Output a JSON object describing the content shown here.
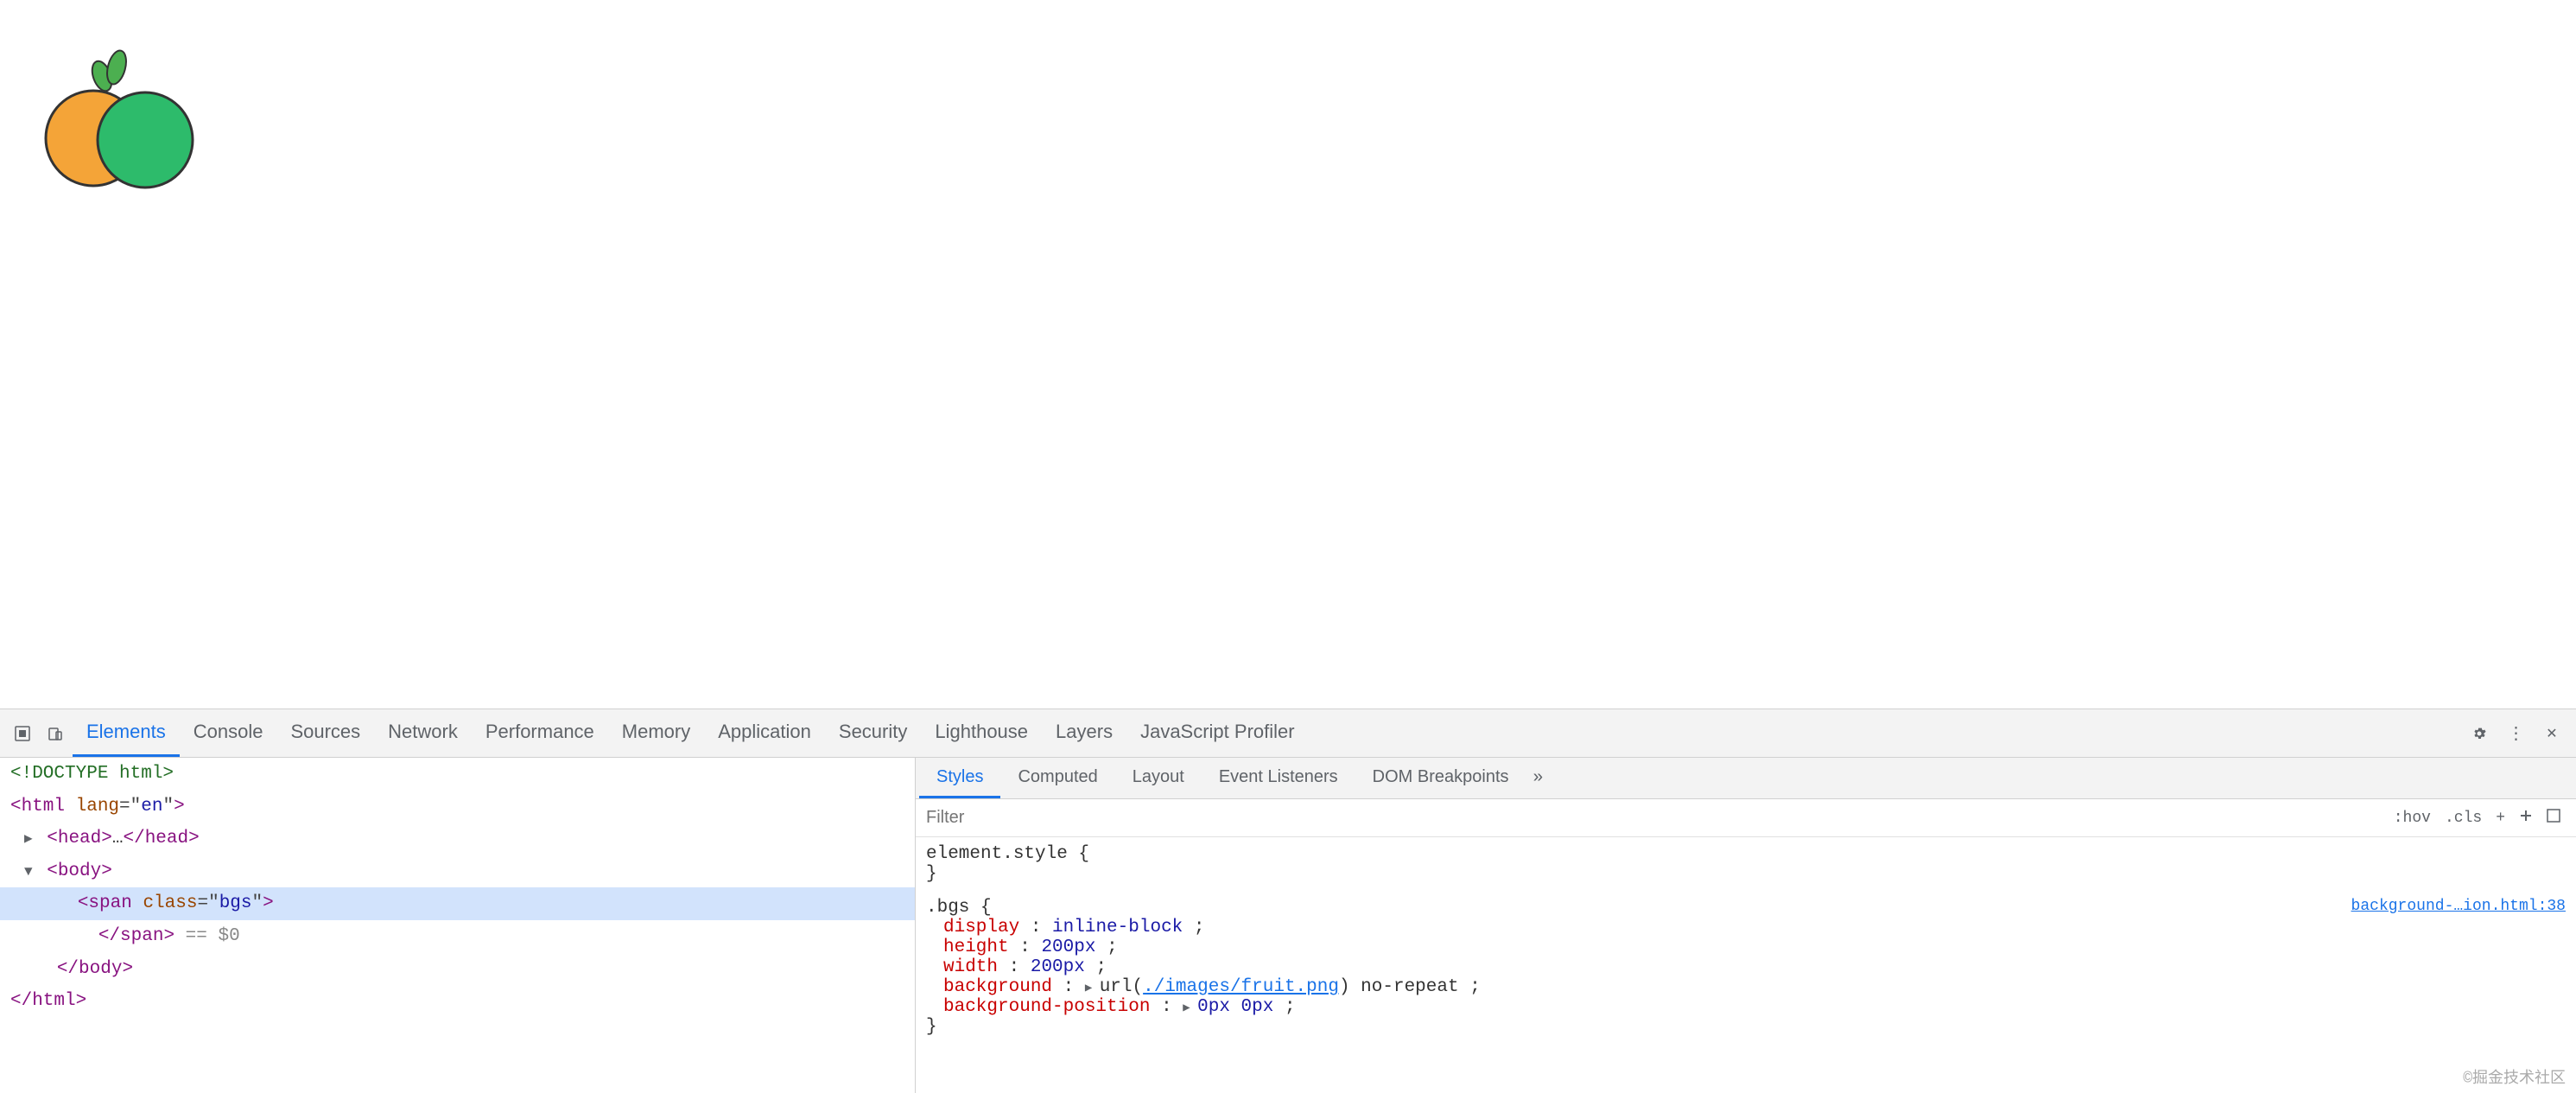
{
  "browser": {
    "viewport_bg": "#ffffff"
  },
  "devtools": {
    "toolbar_icons": [
      {
        "name": "cursor-icon",
        "symbol": "⬚",
        "title": "Select element"
      },
      {
        "name": "device-icon",
        "symbol": "▭",
        "title": "Toggle device toolbar"
      }
    ],
    "tabs": [
      {
        "id": "elements",
        "label": "Elements",
        "active": true
      },
      {
        "id": "console",
        "label": "Console",
        "active": false
      },
      {
        "id": "sources",
        "label": "Sources",
        "active": false
      },
      {
        "id": "network",
        "label": "Network",
        "active": false
      },
      {
        "id": "performance",
        "label": "Performance",
        "active": false
      },
      {
        "id": "memory",
        "label": "Memory",
        "active": false
      },
      {
        "id": "application",
        "label": "Application",
        "active": false
      },
      {
        "id": "security",
        "label": "Security",
        "active": false
      },
      {
        "id": "lighthouse",
        "label": "Lighthouse",
        "active": false
      },
      {
        "id": "layers",
        "label": "Layers",
        "active": false
      },
      {
        "id": "js-profiler",
        "label": "JavaScript Profiler",
        "active": false
      }
    ],
    "right_icons": [
      {
        "name": "settings-icon",
        "symbol": "⚙"
      },
      {
        "name": "more-icon",
        "symbol": "⋮"
      },
      {
        "name": "close-icon",
        "symbol": "✕"
      }
    ]
  },
  "elements_panel": {
    "dom_lines": [
      {
        "id": "doctype",
        "indent": 0,
        "html": "<!DOCTYPE html>",
        "selected": false
      },
      {
        "id": "html-open",
        "indent": 0,
        "html": "<html lang=\"en\">",
        "selected": false
      },
      {
        "id": "head",
        "indent": 1,
        "html": "▶ <head>…</head>",
        "selected": false
      },
      {
        "id": "body-open",
        "indent": 1,
        "html": "▼ <body>",
        "selected": false
      },
      {
        "id": "span-bgs",
        "indent": 2,
        "html": "  <span class=\"bgs\">",
        "selected": true
      },
      {
        "id": "span-close",
        "indent": 3,
        "html": "  </span> == $0",
        "selected": false
      },
      {
        "id": "body-close",
        "indent": 1,
        "html": "  </body>",
        "selected": false
      },
      {
        "id": "html-close",
        "indent": 0,
        "html": "</html>",
        "selected": false
      }
    ]
  },
  "styles_panel": {
    "tabs": [
      {
        "label": "Styles",
        "active": true
      },
      {
        "label": "Computed",
        "active": false
      },
      {
        "label": "Layout",
        "active": false
      },
      {
        "label": "Event Listeners",
        "active": false
      },
      {
        "label": "DOM Breakpoints",
        "active": false
      }
    ],
    "filter_placeholder": "Filter",
    "pseudo_buttons": [
      ":hov",
      ".cls",
      "+"
    ],
    "rules": [
      {
        "selector": "element.style {",
        "close": "}",
        "properties": []
      },
      {
        "selector": ".bgs {",
        "source": "background-…ion.html:38",
        "close": "}",
        "properties": [
          {
            "name": "display",
            "value": "inline-block",
            "colon": ":"
          },
          {
            "name": "height",
            "value": "200px",
            "colon": ":"
          },
          {
            "name": "width",
            "value": "200px",
            "colon": ":"
          },
          {
            "name": "background",
            "value_text": "▶ url(./images/fruit.png) no-repeat",
            "is_url": true,
            "url": "./images/fruit.png",
            "url_display": "./images/fruit.png",
            "colon": ":"
          },
          {
            "name": "background-position",
            "value_text": "▶ 0px 0px",
            "colon": ":"
          }
        ]
      }
    ],
    "watermark": "©掘金技术社区"
  }
}
